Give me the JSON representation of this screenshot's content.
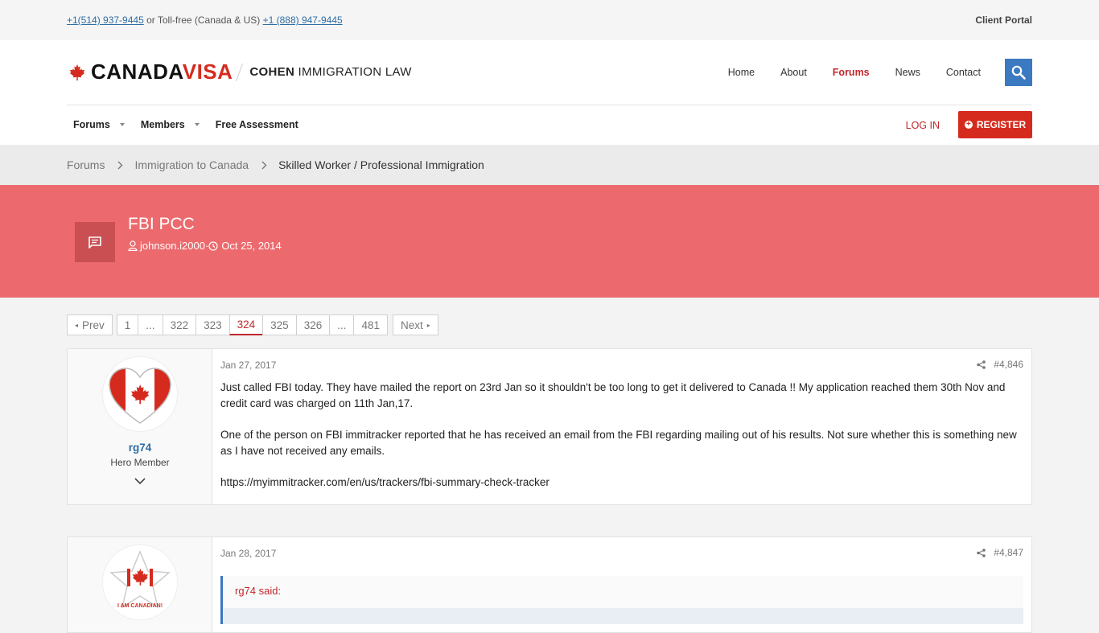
{
  "topbar": {
    "phone_local": "+1(514) 937-9445",
    "phone_connector": " or Toll-free (Canada & US) ",
    "phone_tollfree": "+1 (888) 947-9445",
    "client_portal": "Client Portal"
  },
  "header": {
    "brand_part1": "CANADA",
    "brand_part2": "VISA",
    "cohen_bold": "COHEN",
    "cohen_rest": " IMMIGRATION LAW",
    "nav": [
      {
        "label": "Home"
      },
      {
        "label": "About"
      },
      {
        "label": "Forums"
      },
      {
        "label": "News"
      },
      {
        "label": "Contact"
      }
    ]
  },
  "subnav": {
    "items": [
      {
        "label": "Forums"
      },
      {
        "label": "Members"
      },
      {
        "label": "Free Assessment"
      }
    ],
    "login": "LOG IN",
    "register": "REGISTER"
  },
  "breadcrumb": {
    "items": [
      "Forums",
      "Immigration to Canada",
      "Skilled Worker / Professional Immigration"
    ]
  },
  "thread": {
    "title": "FBI PCC",
    "author": "johnson.i2000",
    "meta_sep": " · ",
    "date": "Oct 25, 2014"
  },
  "pager": {
    "prev": "Prev",
    "next": "Next",
    "pages": [
      "1",
      "...",
      "322",
      "323",
      "324",
      "325",
      "326",
      "...",
      "481"
    ],
    "current": "324"
  },
  "posts": [
    {
      "username": "rg74",
      "user_title": "Hero Member",
      "date": "Jan 27, 2017",
      "number": "#4,846",
      "paragraphs": [
        "Just called FBI today. They have mailed the report on 23rd Jan so it shouldn't be too long to get it delivered to Canada !! My application reached them 30th Nov and credit card was charged on 11th Jan,17.",
        "One of the person on FBI immitracker reported that he has received an email from the FBI regarding mailing out of his results. Not sure whether this is something new as I have not received any emails.",
        "https://myimmitracker.com/en/us/trackers/fbi-summary-check-tracker"
      ]
    },
    {
      "date": "Jan 28, 2017",
      "number": "#4,847",
      "quote_header": "rg74 said:",
      "avatar_caption": "I AM CANADIAN!"
    }
  ],
  "colors": {
    "brand_red": "#d52b1e",
    "banner": "#ec6a6d",
    "link_blue": "#2e6da4",
    "search_blue": "#3b79c0"
  }
}
